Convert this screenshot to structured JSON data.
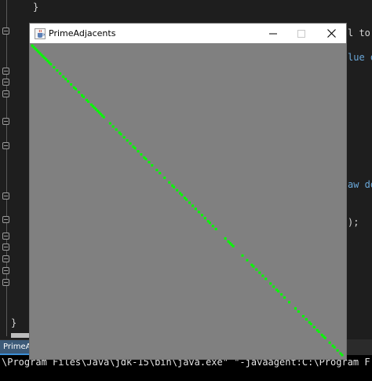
{
  "window": {
    "title": "PrimeAdjacents",
    "minimize_icon": "minimize-icon",
    "maximize_icon": "maximize-icon",
    "close_icon": "close-icon",
    "app_icon": "java-cup-icon"
  },
  "ide": {
    "code_fragments": [
      "}",
      "l to",
      "lue o",
      "aw do",
      ");",
      "}"
    ],
    "tab_label": "PrimeAdjacen",
    "terminal_line": "\\Program Files\\Java\\jdk-15\\bin\\java.exe\" \"-javaagent:C:\\Program F"
  },
  "colors": {
    "canvas_background": "#808080",
    "point": "#00ff00",
    "ide_background": "#1e1e1e",
    "terminal_background": "#000000"
  },
  "chart_data": {
    "type": "scatter",
    "color": "#00ff00",
    "note_points": "points lie along the main diagonal",
    "points": [
      [
        0,
        0
      ],
      [
        2,
        2
      ],
      [
        4,
        4
      ],
      [
        6,
        6
      ],
      [
        8,
        8
      ],
      [
        10,
        10
      ],
      [
        12,
        12
      ],
      [
        14,
        14
      ],
      [
        16,
        16
      ],
      [
        18,
        18
      ],
      [
        20,
        20
      ],
      [
        22,
        22
      ],
      [
        24,
        24
      ],
      [
        28,
        28
      ],
      [
        32,
        32
      ],
      [
        36,
        36
      ],
      [
        40,
        40
      ],
      [
        43,
        43
      ],
      [
        46,
        46
      ],
      [
        50,
        50
      ],
      [
        54,
        54
      ],
      [
        56,
        56
      ],
      [
        60,
        60
      ],
      [
        64,
        64
      ],
      [
        66,
        66
      ],
      [
        70,
        70
      ],
      [
        72,
        72
      ],
      [
        76,
        76
      ],
      [
        78,
        78
      ],
      [
        80,
        80
      ],
      [
        82,
        82
      ],
      [
        84,
        84
      ],
      [
        86,
        86
      ],
      [
        88,
        88
      ],
      [
        90,
        90
      ],
      [
        92,
        92
      ],
      [
        100,
        100
      ],
      [
        104,
        104
      ],
      [
        108,
        108
      ],
      [
        112,
        112
      ],
      [
        114,
        114
      ],
      [
        118,
        118
      ],
      [
        122,
        122
      ],
      [
        126,
        126
      ],
      [
        130,
        130
      ],
      [
        132,
        132
      ],
      [
        136,
        136
      ],
      [
        140,
        140
      ],
      [
        144,
        144
      ],
      [
        146,
        146
      ],
      [
        150,
        150
      ],
      [
        154,
        154
      ],
      [
        160,
        160
      ],
      [
        164,
        164
      ],
      [
        170,
        170
      ],
      [
        176,
        176
      ],
      [
        180,
        180
      ],
      [
        182,
        182
      ],
      [
        186,
        186
      ],
      [
        190,
        190
      ],
      [
        192,
        192
      ],
      [
        196,
        196
      ],
      [
        198,
        198
      ],
      [
        202,
        202
      ],
      [
        206,
        206
      ],
      [
        210,
        210
      ],
      [
        214,
        214
      ],
      [
        218,
        218
      ],
      [
        222,
        222
      ],
      [
        226,
        226
      ],
      [
        228,
        228
      ],
      [
        232,
        232
      ],
      [
        236,
        236
      ],
      [
        248,
        248
      ],
      [
        252,
        252
      ],
      [
        254,
        254
      ],
      [
        256,
        256
      ],
      [
        258,
        258
      ],
      [
        270,
        270
      ],
      [
        276,
        276
      ],
      [
        282,
        282
      ],
      [
        284,
        284
      ],
      [
        288,
        288
      ],
      [
        292,
        292
      ],
      [
        296,
        296
      ],
      [
        300,
        300
      ],
      [
        306,
        306
      ],
      [
        310,
        310
      ],
      [
        314,
        314
      ],
      [
        316,
        316
      ],
      [
        320,
        320
      ],
      [
        324,
        324
      ],
      [
        330,
        330
      ],
      [
        338,
        338
      ],
      [
        342,
        342
      ],
      [
        348,
        348
      ],
      [
        352,
        352
      ],
      [
        356,
        356
      ],
      [
        358,
        358
      ],
      [
        362,
        362
      ],
      [
        366,
        366
      ],
      [
        368,
        368
      ],
      [
        372,
        372
      ],
      [
        374,
        374
      ],
      [
        376,
        376
      ],
      [
        382,
        382
      ],
      [
        386,
        386
      ],
      [
        388,
        388
      ],
      [
        392,
        392
      ],
      [
        396,
        396
      ],
      [
        398,
        398
      ]
    ],
    "xlim": [
      0,
      400
    ],
    "ylim": [
      0,
      400
    ],
    "grid": false,
    "title": "",
    "xlabel": "",
    "ylabel": ""
  }
}
